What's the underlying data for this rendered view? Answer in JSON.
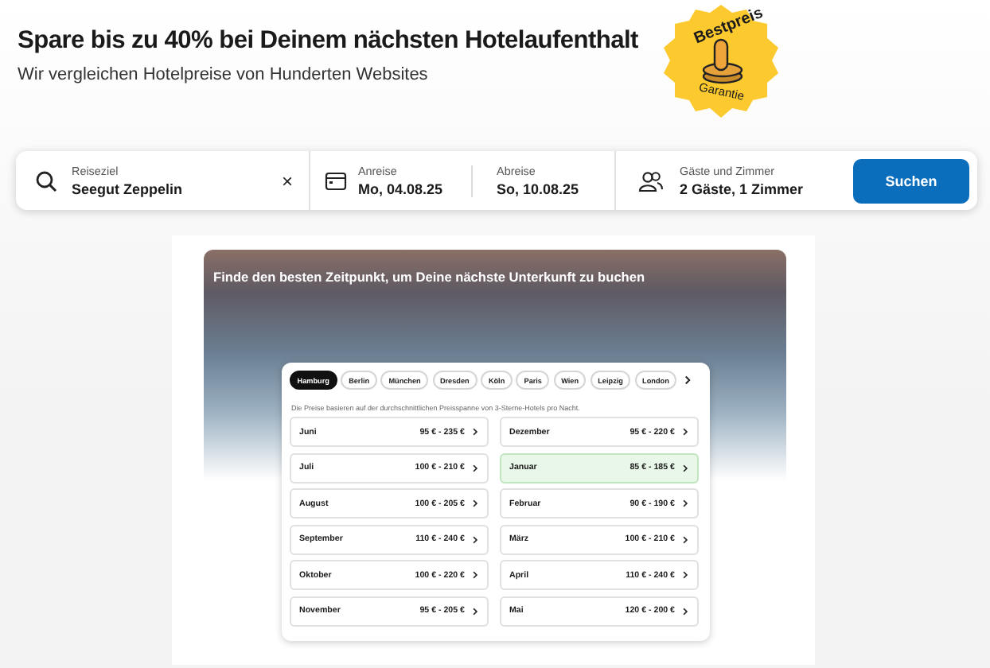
{
  "header": {
    "title": "Spare bis zu 40% bei Deinem nächsten Hotelaufenthalt",
    "subtitle": "Wir vergleichen Hotelpreise von Hunderten Websites"
  },
  "badge": {
    "top": "Bestpreis",
    "bottom": "Garantie"
  },
  "search": {
    "destination": {
      "label": "Reiseziel",
      "value": "Seegut Zeppelin",
      "clear": "×"
    },
    "checkin": {
      "label": "Anreise",
      "value": "Mo, 04.08.25"
    },
    "checkout": {
      "label": "Abreise",
      "value": "So, 10.08.25"
    },
    "guests": {
      "label": "Gäste und Zimmer",
      "value": "2 Gäste, 1 Zimmer"
    },
    "button": "Suchen"
  },
  "promo": {
    "title": "Finde den besten Zeitpunkt, um Deine nächste Unterkunft zu buchen",
    "cities": [
      {
        "label": "Hamburg",
        "selected": true
      },
      {
        "label": "Berlin",
        "selected": false
      },
      {
        "label": "München",
        "selected": false
      },
      {
        "label": "Dresden",
        "selected": false
      },
      {
        "label": "Köln",
        "selected": false
      },
      {
        "label": "Paris",
        "selected": false
      },
      {
        "label": "Wien",
        "selected": false
      },
      {
        "label": "Leipzig",
        "selected": false
      },
      {
        "label": "London",
        "selected": false
      }
    ],
    "note": "Die Preise basieren auf der durchschnittlichen Preisspanne von 3-Sterne-Hotels pro Nacht.",
    "months": [
      {
        "month": "Juni",
        "range": "95 € - 235 €",
        "highlighted": false
      },
      {
        "month": "Juli",
        "range": "100 € - 210 €",
        "highlighted": false
      },
      {
        "month": "August",
        "range": "100 € - 205 €",
        "highlighted": false
      },
      {
        "month": "September",
        "range": "110 € - 240 €",
        "highlighted": false
      },
      {
        "month": "Oktober",
        "range": "100 € - 220 €",
        "highlighted": false
      },
      {
        "month": "November",
        "range": "95 € - 205 €",
        "highlighted": false
      },
      {
        "month": "Dezember",
        "range": "95 € - 220 €",
        "highlighted": false
      },
      {
        "month": "Januar",
        "range": "85 € - 185 €",
        "highlighted": true
      },
      {
        "month": "Februar",
        "range": "90 € - 190 €",
        "highlighted": false
      },
      {
        "month": "März",
        "range": "100 € - 210 €",
        "highlighted": false
      },
      {
        "month": "April",
        "range": "110 € - 240 €",
        "highlighted": false
      },
      {
        "month": "Mai",
        "range": "120 € - 200 €",
        "highlighted": false
      }
    ]
  }
}
